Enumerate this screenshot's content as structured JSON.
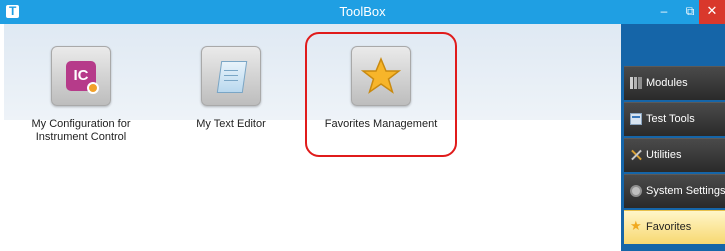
{
  "window": {
    "title": "ToolBox",
    "controls": {
      "minimize": "–",
      "restore": "⧉",
      "close": "✕"
    }
  },
  "tools": [
    {
      "label": "My Configuration for Instrument Control",
      "icon": "instrument-control-icon"
    },
    {
      "label": "My Text Editor",
      "icon": "text-editor-icon"
    },
    {
      "label": "Favorites Management",
      "icon": "star-icon",
      "highlighted": true
    }
  ],
  "sidebar": {
    "items": [
      {
        "label": "Modules",
        "icon": "modules-icon"
      },
      {
        "label": "Test Tools",
        "icon": "test-tools-icon"
      },
      {
        "label": "Utilities",
        "icon": "utilities-icon"
      },
      {
        "label": "System Settings",
        "icon": "system-settings-icon"
      },
      {
        "label": "Favorites",
        "icon": "star-icon",
        "active": true
      }
    ]
  },
  "colors": {
    "titlebar": "#1f9fe3",
    "sidebar": "#1565a8",
    "highlight": "#e01b1b",
    "active_nav": "#f7d871"
  }
}
